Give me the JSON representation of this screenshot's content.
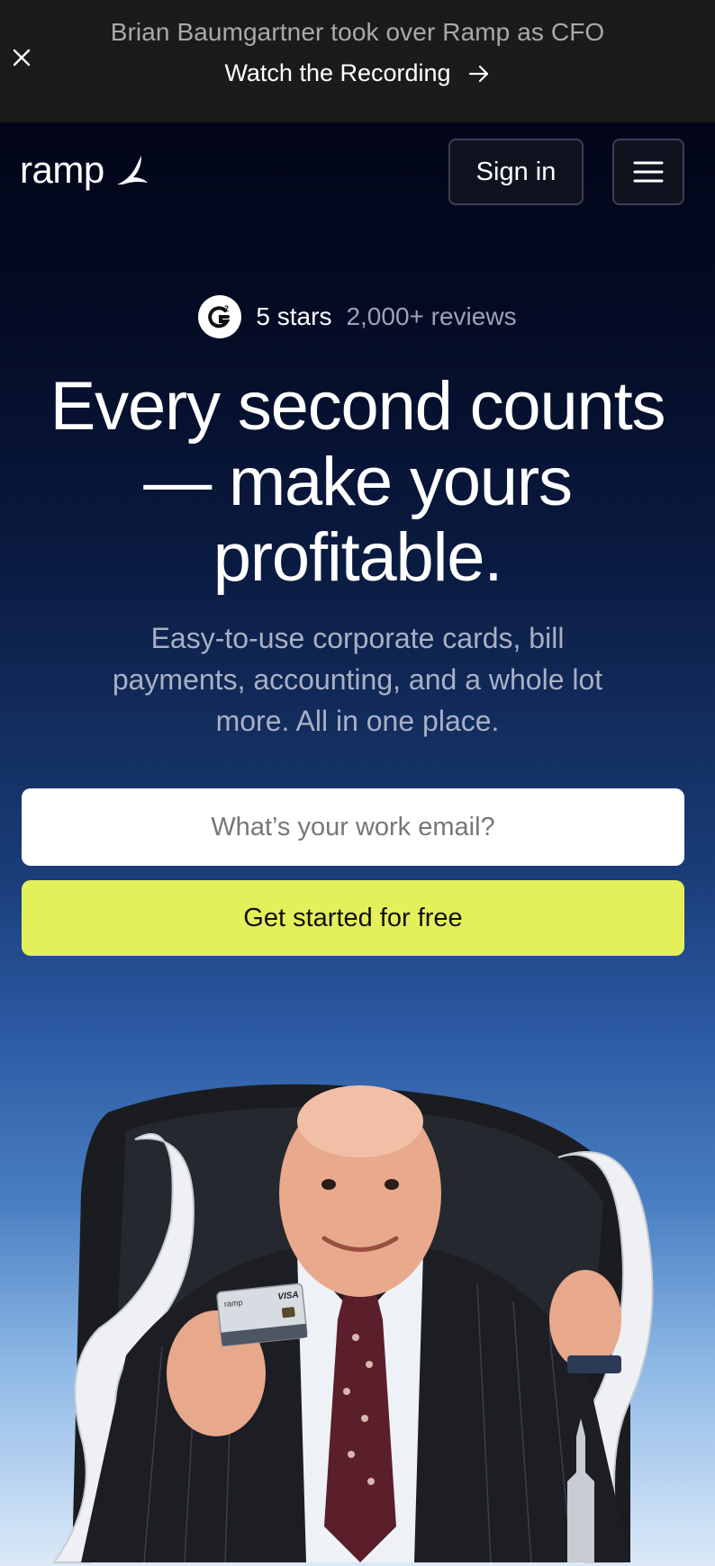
{
  "banner": {
    "headline": "Brian Baumgartner took over Ramp as CFO",
    "cta_label": "Watch the Recording",
    "close_icon": "close-icon",
    "arrow_icon": "arrow-right-icon"
  },
  "nav": {
    "logo_text": "ramp",
    "logo_icon": "ramp-wing-icon",
    "signin_label": "Sign in",
    "menu_icon": "hamburger-menu-icon"
  },
  "hero": {
    "rating_icon": "g2-icon",
    "stars_label": "5 stars",
    "reviews_label": "2,000+ reviews",
    "title": "Every second counts — make yours profitable.",
    "subtitle": "Easy-to-use corporate cards, bill payments, accounting, and a whole lot more. All in one place.",
    "email_placeholder": "What’s your work email?",
    "email_value": "",
    "cta_label": "Get started for free",
    "card_text": "ramp",
    "card_brand": "VISA"
  },
  "colors": {
    "banner_bg": "#1b1b1b",
    "hero_top": "#03061a",
    "hero_bottom": "#dbe9f8",
    "cta_bg": "#e4f05a"
  }
}
